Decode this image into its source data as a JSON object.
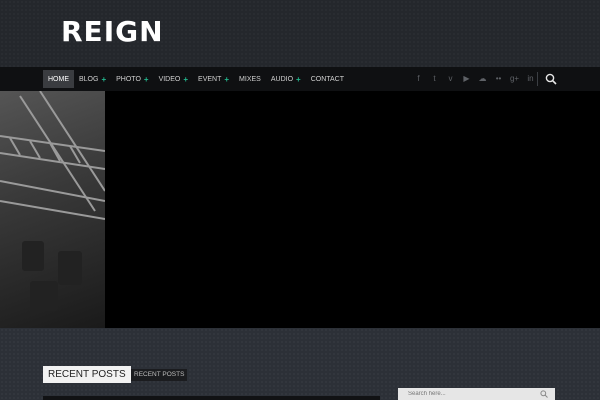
{
  "site": {
    "logo": "REIGN"
  },
  "nav": {
    "items": [
      {
        "label": "HOME",
        "active": true,
        "plus": false
      },
      {
        "label": "BLOG",
        "plus": true
      },
      {
        "label": "PHOTO",
        "plus": true
      },
      {
        "label": "VIDEO",
        "plus": true
      },
      {
        "label": "EVENT",
        "plus": true
      },
      {
        "label": "MIXES",
        "plus": false
      },
      {
        "label": "AUDIO",
        "plus": true
      },
      {
        "label": "CONTACT",
        "plus": false
      }
    ],
    "plus_symbol": "+",
    "social_icons": [
      "facebook-icon",
      "twitter-icon",
      "vimeo-icon",
      "youtube-icon",
      "soundcloud-icon",
      "flickr-icon",
      "google-plus-icon",
      "linkedin-icon"
    ],
    "social_glyphs": [
      "f",
      "t",
      "v",
      "▶",
      "☁",
      "••",
      "g+",
      "in"
    ]
  },
  "recent": {
    "title": "RECENT POSTS",
    "tab": "RECENT POSTS"
  },
  "sidebar": {
    "search_placeholder": "Search here..."
  },
  "colors": {
    "accent": "#23b88e",
    "hero_bg": "#000000"
  }
}
